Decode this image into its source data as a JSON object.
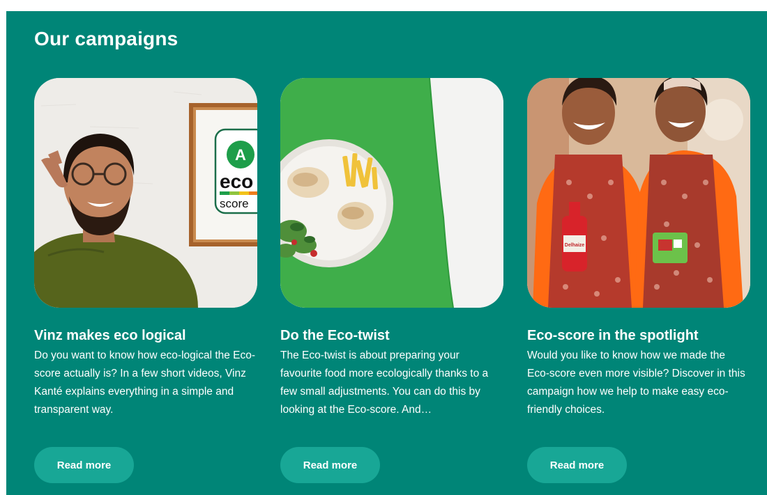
{
  "section": {
    "title": "Our campaigns",
    "background_color": "#008577",
    "button_color": "#18a796"
  },
  "cards": [
    {
      "title": "Vinz makes eco logical",
      "description": "Do you want to know how eco-logical the Eco-score actually is? In a few short videos, Vinz Kanté explains everything in a simple and transparent way.",
      "button_label": "Read more",
      "image": {
        "subject": "man-with-glasses-and-eco-score-poster",
        "poster_letter": "A",
        "poster_text_1": "eco",
        "poster_text_2": "score"
      }
    },
    {
      "title": "Do the Eco-twist",
      "description": "The Eco-twist is about preparing your favourite food more ecologically thanks to a few small adjustments. You can do this by looking at the Eco-score. And…",
      "button_label": "Read more",
      "image": {
        "subject": "plate-of-food-on-green-background"
      }
    },
    {
      "title": "Eco-score in the spotlight",
      "description": "Would you like to know how we made the Eco-score even more visible? Discover in this campaign how we help to make easy eco-friendly choices.",
      "button_label": "Read more",
      "image": {
        "subject": "two-girls-in-aprons-holding-products",
        "bottle_label": "Delhaize"
      }
    }
  ]
}
